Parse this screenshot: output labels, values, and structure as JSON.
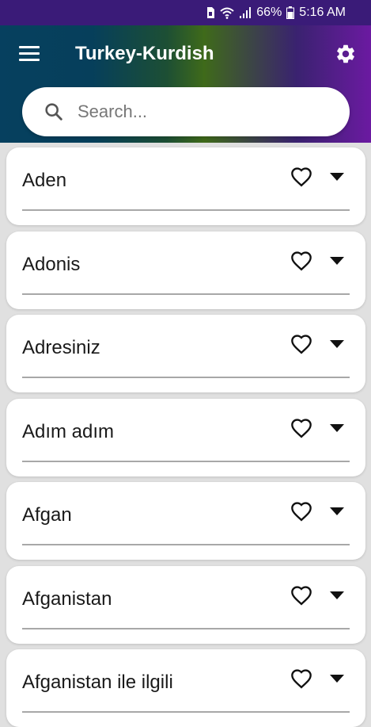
{
  "status_bar": {
    "battery": "66%",
    "time": "5:16 AM"
  },
  "app": {
    "title": "Turkey-Kurdish",
    "menu_icon": "hamburger-menu-icon",
    "settings_icon": "gear-icon"
  },
  "search": {
    "placeholder": "Search...",
    "value": "",
    "icon": "search-icon"
  },
  "colors": {
    "status_bar": "#3a1b78",
    "header_start": "#06405f",
    "header_mid": "#3f6a1a",
    "header_end": "#6b1aa1",
    "background": "#e0e0e0",
    "card": "#ffffff"
  },
  "words": [
    {
      "label": "Aden"
    },
    {
      "label": "Adonis"
    },
    {
      "label": "Adresiniz"
    },
    {
      "label": "Adım adım"
    },
    {
      "label": "Afgan"
    },
    {
      "label": "Afganistan"
    },
    {
      "label": "Afganistan ile ilgili"
    }
  ]
}
